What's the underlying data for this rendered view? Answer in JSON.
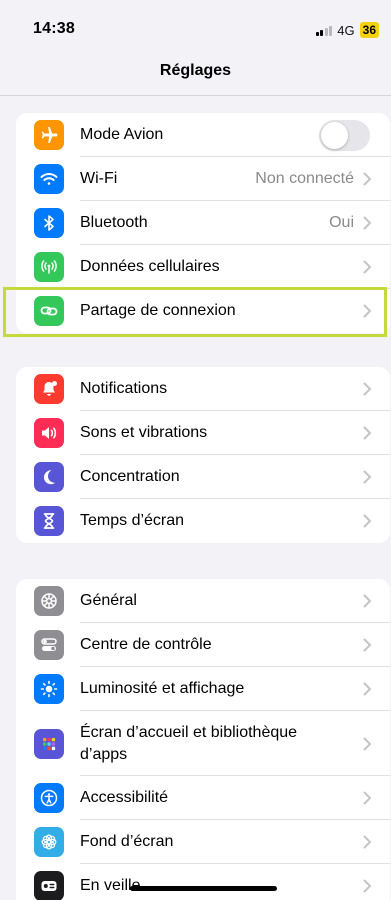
{
  "status": {
    "time": "14:38",
    "network": "4G",
    "battery": "36"
  },
  "nav": {
    "title": "Réglages"
  },
  "group1": [
    {
      "label": "Mode Avion",
      "icon": "airplane-icon",
      "color": "#ff9500",
      "control": "toggle",
      "toggle_on": false
    },
    {
      "label": "Wi-Fi",
      "icon": "wifi-icon",
      "color": "#007aff",
      "value": "Non connecté"
    },
    {
      "label": "Bluetooth",
      "icon": "bluetooth-icon",
      "color": "#007aff",
      "value": "Oui"
    },
    {
      "label": "Données cellulaires",
      "icon": "antenna-icon",
      "color": "#34c759",
      "value": ""
    },
    {
      "label": "Partage de connexion",
      "icon": "link-icon",
      "color": "#34c759",
      "value": ""
    }
  ],
  "group2": [
    {
      "label": "Notifications",
      "icon": "bell-icon",
      "color": "#ff3b30"
    },
    {
      "label": "Sons et vibrations",
      "icon": "speaker-icon",
      "color": "#ff2d55"
    },
    {
      "label": "Concentration",
      "icon": "moon-icon",
      "color": "#5856d6"
    },
    {
      "label": "Temps d’écran",
      "icon": "hourglass-icon",
      "color": "#5856d6"
    }
  ],
  "group3": [
    {
      "label": "Général",
      "icon": "gear-icon",
      "color": "#8e8e93"
    },
    {
      "label": "Centre de contrôle",
      "icon": "switches-icon",
      "color": "#8e8e93"
    },
    {
      "label": "Luminosité et affichage",
      "icon": "sun-icon",
      "color": "#007aff"
    },
    {
      "label": "Écran d’accueil et bibliothèque d’apps",
      "icon": "app-grid-icon",
      "color": "#5856d6"
    },
    {
      "label": "Accessibilité",
      "icon": "accessibility-icon",
      "color": "#007aff"
    },
    {
      "label": "Fond d’écran",
      "icon": "flower-icon",
      "color": "#32ade6"
    },
    {
      "label": "En veille",
      "icon": "standby-icon",
      "color": "#1c1c1e"
    }
  ]
}
